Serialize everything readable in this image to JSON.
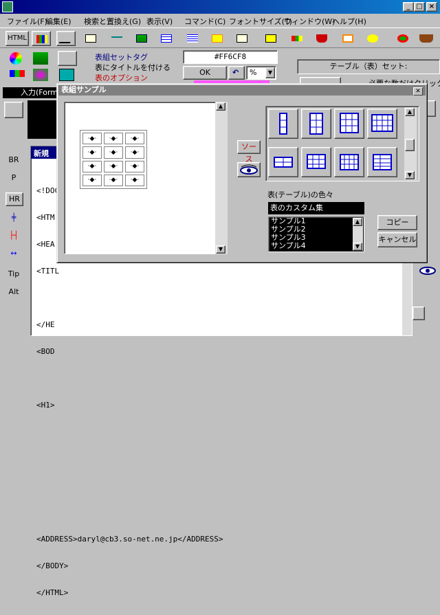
{
  "menu": [
    "ファイル(F)",
    "編集(E)",
    "検索と置換え(G)",
    "表示(V)",
    "コマンド(C)",
    "フォントサイズ(T)",
    "ウィンドウ(W)",
    "ヘルプ(H)"
  ],
  "toolbar": {
    "html_label": "HTML"
  },
  "tag_panel": {
    "line1": "表組セットタグ",
    "line2": "表にタイトルを付ける",
    "line3": "表のオプション",
    "input_label": "入力(Form"
  },
  "color": {
    "hex": "#FF6CF8",
    "ok_label": "OK",
    "percent": "%"
  },
  "right_panel": {
    "title": "テーブル（表）セット:",
    "hint": "必要な数だけクリック"
  },
  "side_labels": [
    "BR",
    "P",
    "HR",
    "Tip",
    "Alt"
  ],
  "editor": {
    "title": "新規",
    "lines": [
      "<!DOC",
      "<HTM",
      "<HEA",
      "<TITL",
      "",
      "</HE",
      "<BOD",
      "",
      "<H1>",
      "",
      "",
      "",
      "",
      "<ADDRESS>daryl@cb3.so-net.ne.jp</ADDRESS>",
      "</BODY>",
      "</HTML>"
    ]
  },
  "dialog": {
    "title": "表組サンプル",
    "source_label": "ソース",
    "colors_label": "表(テーブル)の色々",
    "colorset_value": "表のカスタム集",
    "samples": [
      "サンプル1",
      "サンプル2",
      "サンプル3",
      "サンプル4"
    ],
    "copy_label": "コピー",
    "cancel_label": "キャンセル",
    "cell_symbol": "·◆·"
  }
}
